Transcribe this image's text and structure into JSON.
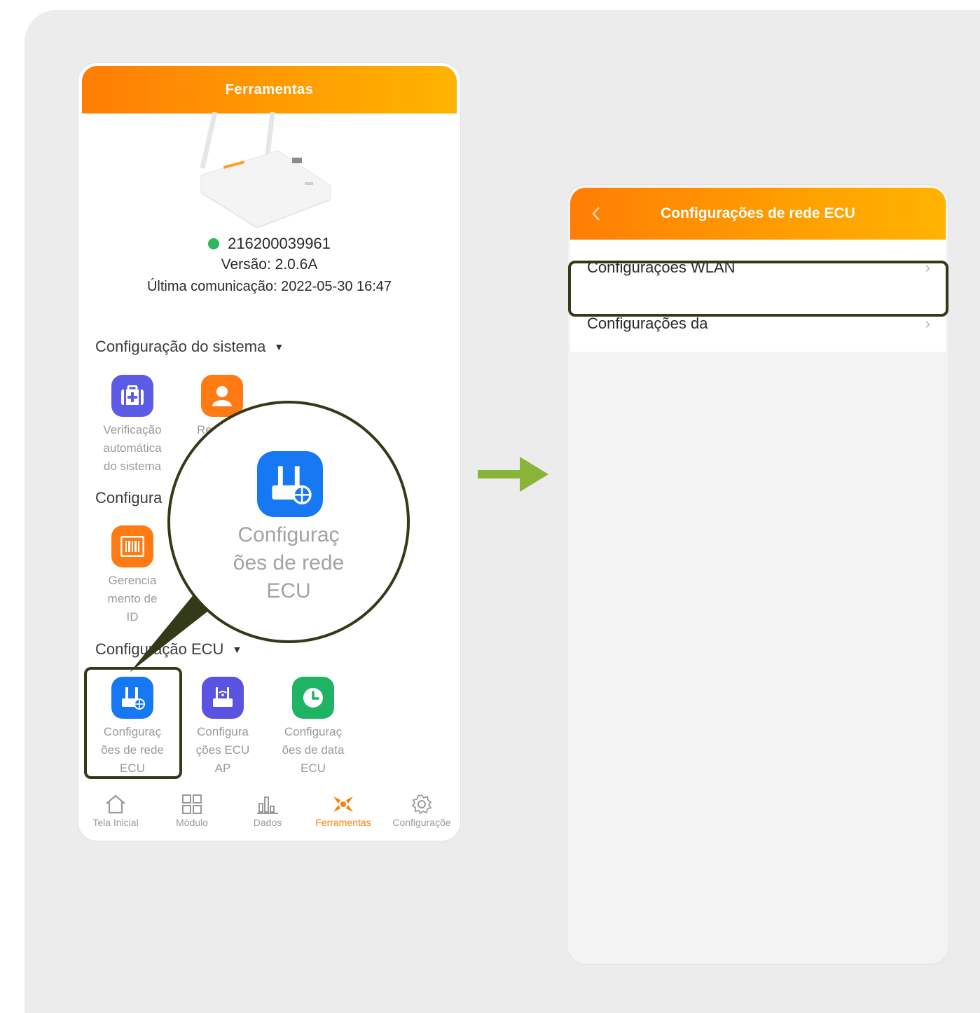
{
  "left_screen": {
    "header_title": "Ferramentas",
    "device": {
      "serial": "216200039961",
      "version": "Versão: 2.0.6A",
      "last_communication": "Última comunicação: 2022-05-30 16:47"
    },
    "sections": {
      "system": "Configuração do sistema",
      "config": "Configura",
      "ecu": "Configuração ECU"
    },
    "tools": {
      "auto_check": "Verificação\nautomática\ndo sistema",
      "second_partial": "Re",
      "id_management": "Gerencia\nmento de\nID",
      "ecu_network": "Configuraç\nões de rede\nECU",
      "ecu_ap": "Configura\nções ECU\nAP",
      "ecu_date": "Configuraç\nões de data\nECU"
    },
    "zoom_label": "Configuraç\nões de rede\nECU",
    "tabs": [
      "Tela Inicial",
      "Módulo",
      "Dados",
      "Ferramentas",
      "Configuraçõe"
    ],
    "active_tab": "Ferramentas"
  },
  "right_screen": {
    "header_title": "Configurações de rede ECU",
    "items": [
      "Configurações WLAN",
      "Configurações da"
    ]
  },
  "colors": {
    "header_gradient_start": "#ff7d05",
    "header_gradient_end": "#ffb300",
    "highlight": "#333a17",
    "arrow": "#8ab437",
    "online": "#2eb65a"
  }
}
